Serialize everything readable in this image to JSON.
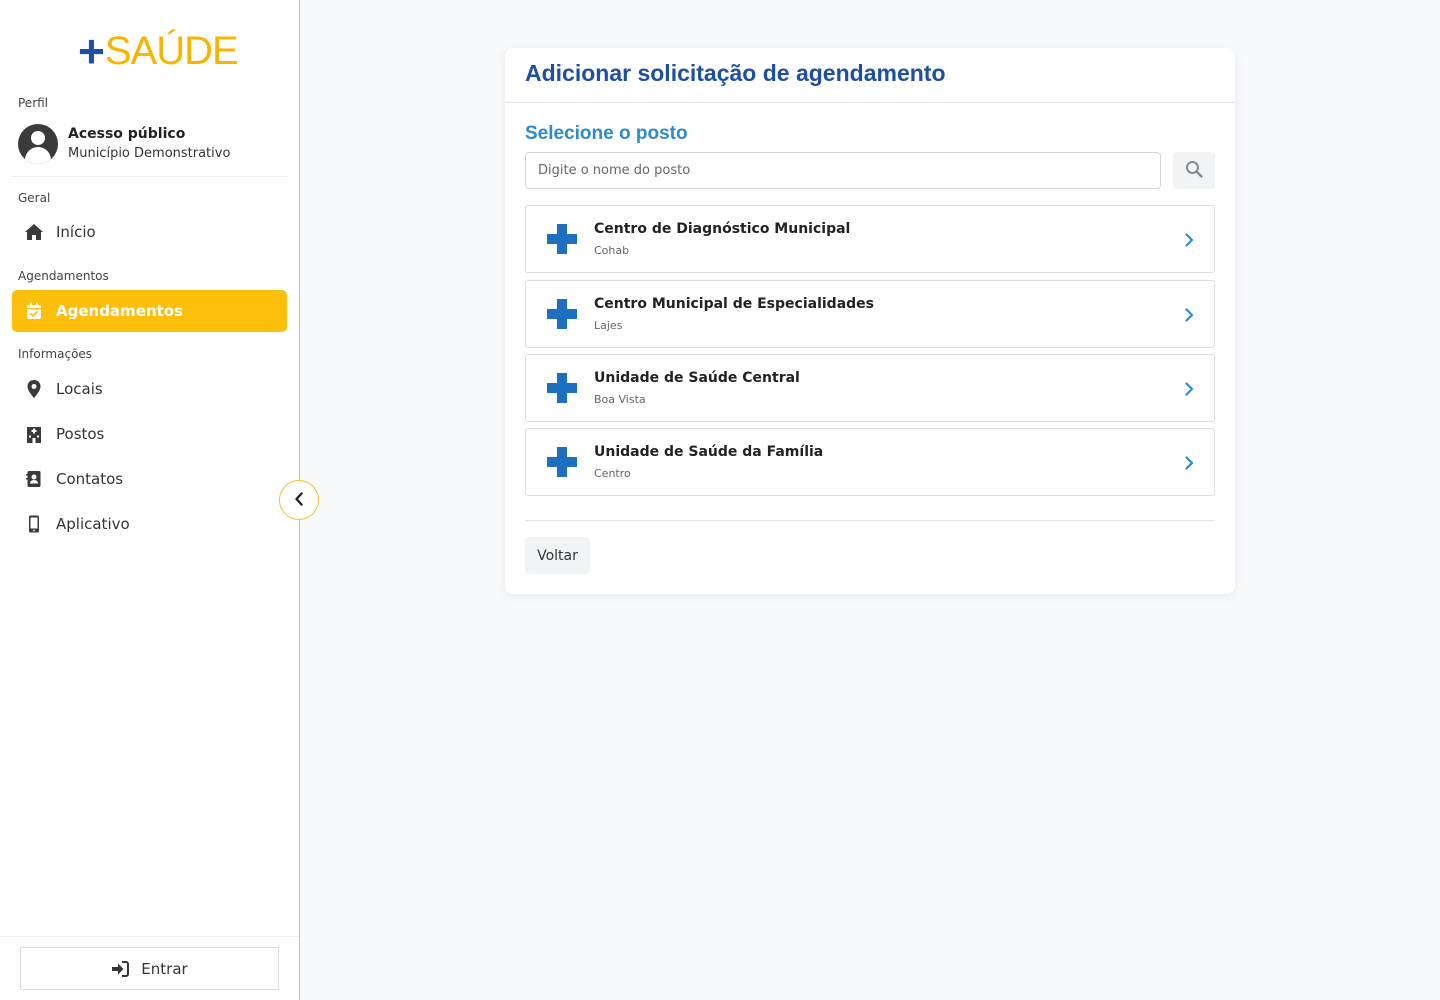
{
  "brand": {
    "plus": "+",
    "word": "SAÚDE"
  },
  "sidebar": {
    "profile_section": "Perfil",
    "profile_name": "Acesso público",
    "profile_city": "Município Demonstrativo",
    "section_geral": "Geral",
    "section_agendamentos": "Agendamentos",
    "section_informacoes": "Informações",
    "items": [
      {
        "label": "Início",
        "icon": "home-icon"
      },
      {
        "label": "Agendamentos",
        "icon": "calendar-check-icon",
        "active": true
      },
      {
        "label": "Locais",
        "icon": "map-marker-icon"
      },
      {
        "label": "Postos",
        "icon": "hospital-building-icon"
      },
      {
        "label": "Contatos",
        "icon": "address-book-icon"
      },
      {
        "label": "Aplicativo",
        "icon": "mobile-phone-icon"
      }
    ],
    "login_label": "Entrar"
  },
  "main": {
    "title": "Adicionar solicitação de agendamento",
    "select_title": "Selecione o posto",
    "search_placeholder": "Digite o nome do posto",
    "postos": [
      {
        "name": "Centro de Diagnóstico Municipal",
        "bairro": "Cohab"
      },
      {
        "name": "Centro Municipal de Especialidades",
        "bairro": "Lajes"
      },
      {
        "name": "Unidade de Saúde Central",
        "bairro": "Boa Vista"
      },
      {
        "name": "Unidade de Saúde da Família",
        "bairro": "Centro"
      }
    ],
    "back_label": "Voltar"
  },
  "colors": {
    "brand_blue": "#1f4fa3",
    "brand_yellow": "#fbbf0c",
    "accent_blue": "#2d8bc9",
    "cross_blue": "#1e6fc0"
  }
}
